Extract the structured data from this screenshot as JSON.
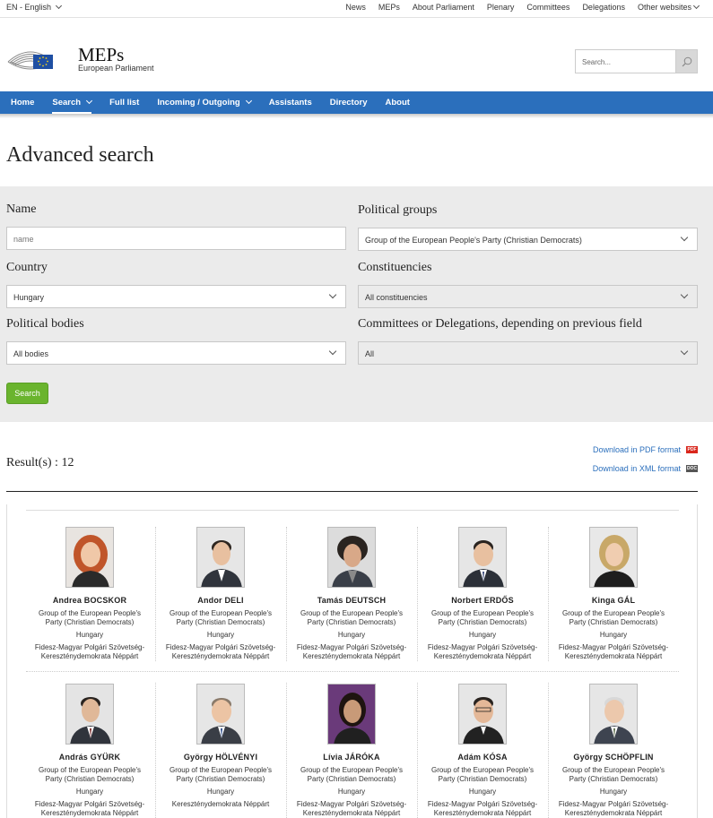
{
  "topbar": {
    "language": "EN - English",
    "links": [
      "News",
      "MEPs",
      "About Parliament",
      "Plenary",
      "Committees",
      "Delegations",
      "Other websites"
    ]
  },
  "header": {
    "title": "MEPs",
    "subtitle": "European Parliament",
    "search_placeholder": "Search..."
  },
  "nav": {
    "items": [
      "Home",
      "Search",
      "Full list",
      "Incoming / Outgoing",
      "Assistants",
      "Directory",
      "About"
    ]
  },
  "page": {
    "title": "Advanced search"
  },
  "form": {
    "name_label": "Name",
    "name_placeholder": "name",
    "political_groups_label": "Political groups",
    "political_groups_value": "Group of the European People's Party (Christian Democrats)",
    "country_label": "Country",
    "country_value": "Hungary",
    "constituencies_label": "Constituencies",
    "constituencies_value": "All constituencies",
    "political_bodies_label": "Political bodies",
    "political_bodies_value": "All bodies",
    "committees_label": "Committees or Delegations, depending on previous field",
    "committees_value": "All",
    "search_button": "Search"
  },
  "results": {
    "label": "Result(s) : 12",
    "download_pdf": "Download in PDF format",
    "download_pdf_badge": "PDF",
    "download_xml": "Download in XML format",
    "download_xml_badge": "DOC",
    "meps": [
      {
        "name": "Andrea BOCSKOR",
        "group": "Group of the European People's Party (Christian Democrats)",
        "country": "Hungary",
        "party": "Fidesz-Magyar Polgári Szövetség-Kereszténydemokrata Néppárt"
      },
      {
        "name": "Andor DELI",
        "group": "Group of the European People's Party (Christian Democrats)",
        "country": "Hungary",
        "party": "Fidesz-Magyar Polgári Szövetség-Kereszténydemokrata Néppárt"
      },
      {
        "name": "Tamás DEUTSCH",
        "group": "Group of the European People's Party (Christian Democrats)",
        "country": "Hungary",
        "party": "Fidesz-Magyar Polgári Szövetség-Kereszténydemokrata Néppárt"
      },
      {
        "name": "Norbert ERDŐS",
        "group": "Group of the European People's Party (Christian Democrats)",
        "country": "Hungary",
        "party": "Fidesz-Magyar Polgári Szövetség-Kereszténydemokrata Néppárt"
      },
      {
        "name": "Kinga GÁL",
        "group": "Group of the European People's Party (Christian Democrats)",
        "country": "Hungary",
        "party": "Fidesz-Magyar Polgári Szövetség-Kereszténydemokrata Néppárt"
      },
      {
        "name": "András GYÜRK",
        "group": "Group of the European People's Party (Christian Democrats)",
        "country": "Hungary",
        "party": "Fidesz-Magyar Polgári Szövetség-Kereszténydemokrata Néppárt"
      },
      {
        "name": "György HÖLVÉNYI",
        "group": "Group of the European People's Party (Christian Democrats)",
        "country": "Hungary",
        "party": "Kereszténydemokrata Néppárt"
      },
      {
        "name": "Lívia JÁRÓKA",
        "group": "Group of the European People's Party (Christian Democrats)",
        "country": "Hungary",
        "party": "Fidesz-Magyar Polgári Szövetség-Kereszténydemokrata Néppárt"
      },
      {
        "name": "Adám KÓSA",
        "group": "Group of the European People's Party (Christian Democrats)",
        "country": "Hungary",
        "party": "Fidesz-Magyar Polgári Szövetség-Kereszténydemokrata Néppárt"
      },
      {
        "name": "György SCHÖPFLIN",
        "group": "Group of the European People's Party (Christian Democrats)",
        "country": "Hungary",
        "party": "Fidesz-Magyar Polgári Szövetség-Kereszténydemokrata Néppárt"
      }
    ]
  },
  "colors": {
    "nav_blue": "#2b6fbc",
    "search_green": "#6ab42e",
    "panel_grey": "#ebebeb",
    "pdf_red": "#d9261c",
    "doc_grey": "#555555"
  }
}
